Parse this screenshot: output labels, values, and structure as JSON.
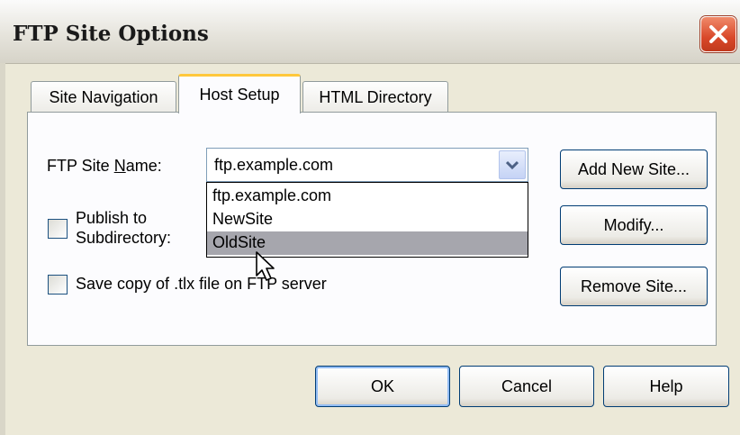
{
  "window": {
    "title": "FTP Site Options",
    "close_icon": "close-icon"
  },
  "tabs": [
    {
      "label": "Site Navigation",
      "active": false
    },
    {
      "label": "Host Setup",
      "active": true
    },
    {
      "label": "HTML Directory",
      "active": false
    }
  ],
  "host_setup": {
    "site_name_label_pre": "FTP Site ",
    "site_name_label_u": "N",
    "site_name_label_post": "ame:",
    "site_name_value": "ftp.example.com",
    "dropdown_options": [
      "ftp.example.com",
      "NewSite",
      "OldSite"
    ],
    "highlighted_option": "OldSite",
    "publish_label_line1": "Publish to",
    "publish_label_line2": "Subdirectory:",
    "publish_checked": false,
    "save_copy_label": "Save copy of .tlx file on FTP server",
    "save_copy_checked": false,
    "add_site_label": "Add New Site...",
    "modify_label": "Modify...",
    "remove_site_label": "Remove Site..."
  },
  "footer": {
    "ok_label": "OK",
    "cancel_label": "Cancel",
    "help_label": "Help"
  },
  "colors": {
    "dialog_bg": "#ece9d8",
    "close_button": "#d9482a",
    "active_tab_accent": "#ffc83c",
    "highlight": "#a6a6ad"
  }
}
